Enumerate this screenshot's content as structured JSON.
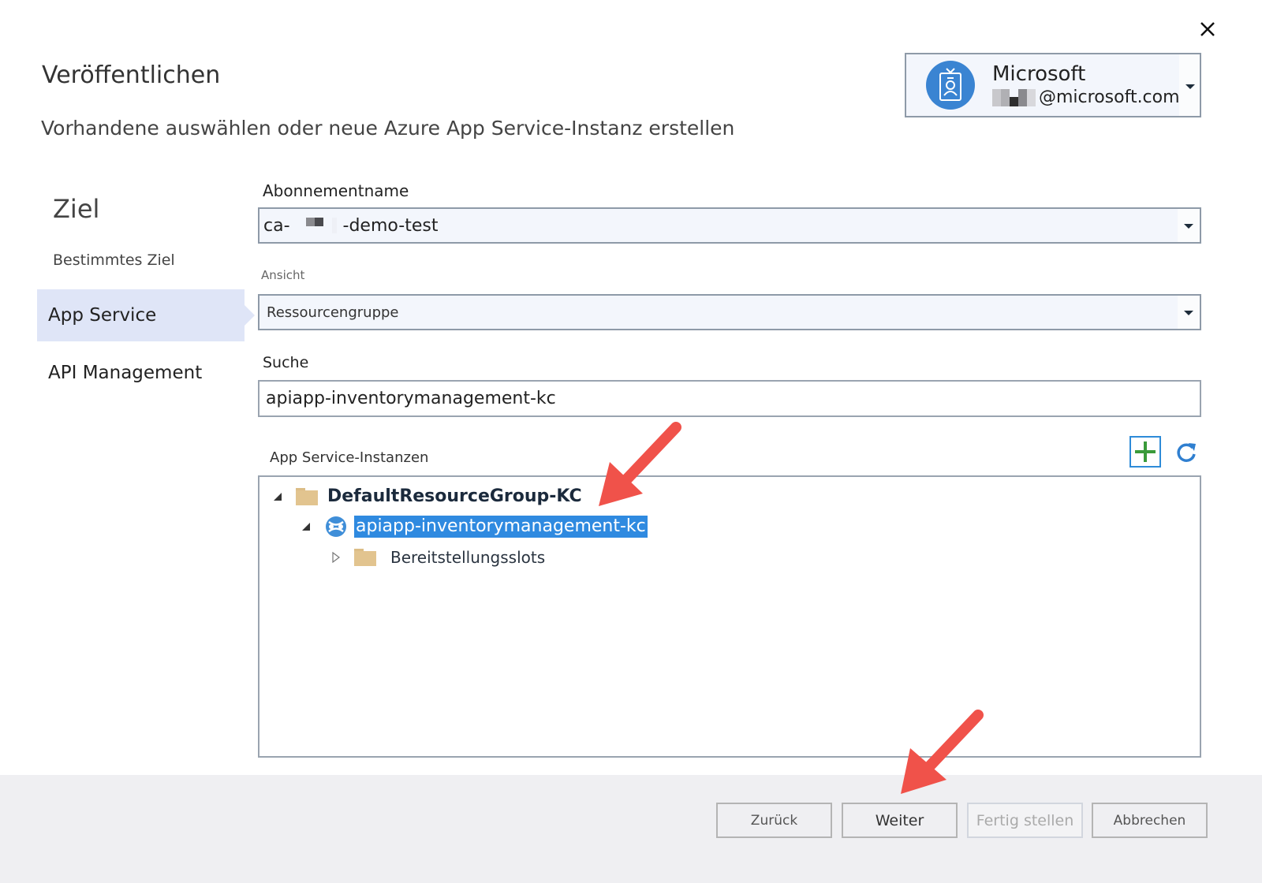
{
  "dialog": {
    "title": "Veröffentlichen",
    "subtitle": "Vorhandene auswählen oder neue Azure App Service-Instanz erstellen",
    "close_icon": "close-icon"
  },
  "account": {
    "name": "Microsoft",
    "email_suffix": "@microsoft.com",
    "avatar_icon": "badge-icon"
  },
  "nav": {
    "heading": "Ziel",
    "items": [
      {
        "label": "Bestimmtes Ziel",
        "active": false
      },
      {
        "label": "App Service",
        "active": true
      },
      {
        "label": "API Management",
        "active": false
      }
    ]
  },
  "form": {
    "subscription_label": "Abonnementname",
    "subscription_prefix": "ca-",
    "subscription_suffix": "-demo-test",
    "view_label": "Ansicht",
    "view_value": "Ressourcengruppe",
    "search_label": "Suche",
    "search_value": "apiapp-inventorymanagement-kc",
    "instances_label": "App Service-Instanzen",
    "add_icon": "plus-icon",
    "refresh_icon": "refresh-icon"
  },
  "tree": {
    "group": "DefaultResourceGroup-KC",
    "app": "apiapp-inventorymanagement-kc",
    "slots": "Bereitstellungsslots"
  },
  "footer": {
    "back": "Zurück",
    "next": "Weiter",
    "finish": "Fertig stellen",
    "cancel": "Abbrechen"
  },
  "colors": {
    "accent": "#2f8ae0",
    "selected_nav": "#dfe5f7",
    "annotation_arrow": "#f0524a"
  }
}
